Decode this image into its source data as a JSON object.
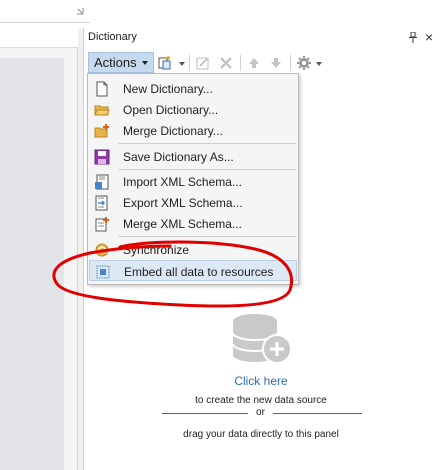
{
  "panel": {
    "title": "Dictionary",
    "pin_icon": "pin-icon",
    "close_icon": "close-icon"
  },
  "toolbar": {
    "actions_label": "Actions",
    "icons": [
      "new-item-icon",
      "edit-icon",
      "delete-icon",
      "move-up-icon",
      "move-down-icon",
      "settings-icon"
    ]
  },
  "menu": {
    "items": [
      {
        "label": "New Dictionary...",
        "icon": "new-document-icon"
      },
      {
        "label": "Open Dictionary...",
        "icon": "open-folder-icon"
      },
      {
        "label": "Merge Dictionary...",
        "icon": "merge-folder-icon"
      },
      {
        "label": "Save Dictionary As...",
        "icon": "save-icon"
      },
      {
        "label": "Import XML Schema...",
        "icon": "import-xml-icon"
      },
      {
        "label": "Export XML Schema...",
        "icon": "export-xml-icon"
      },
      {
        "label": "Merge XML Schema...",
        "icon": "merge-xml-icon"
      },
      {
        "label": "Synchronize",
        "icon": "synchronize-icon"
      },
      {
        "label": "Embed all data to resources",
        "icon": "embed-data-icon"
      }
    ]
  },
  "empty_state": {
    "link": "Click here",
    "line1": "to create the new data source",
    "or": "or",
    "line2": "drag your data directly to this panel",
    "icon": "database-add-icon"
  },
  "colors": {
    "accent_link": "#2a6fb7",
    "actions_button_bg": "#c6d9ef",
    "highlight_bg": "#dde8f5",
    "annotation": "#e00000"
  }
}
